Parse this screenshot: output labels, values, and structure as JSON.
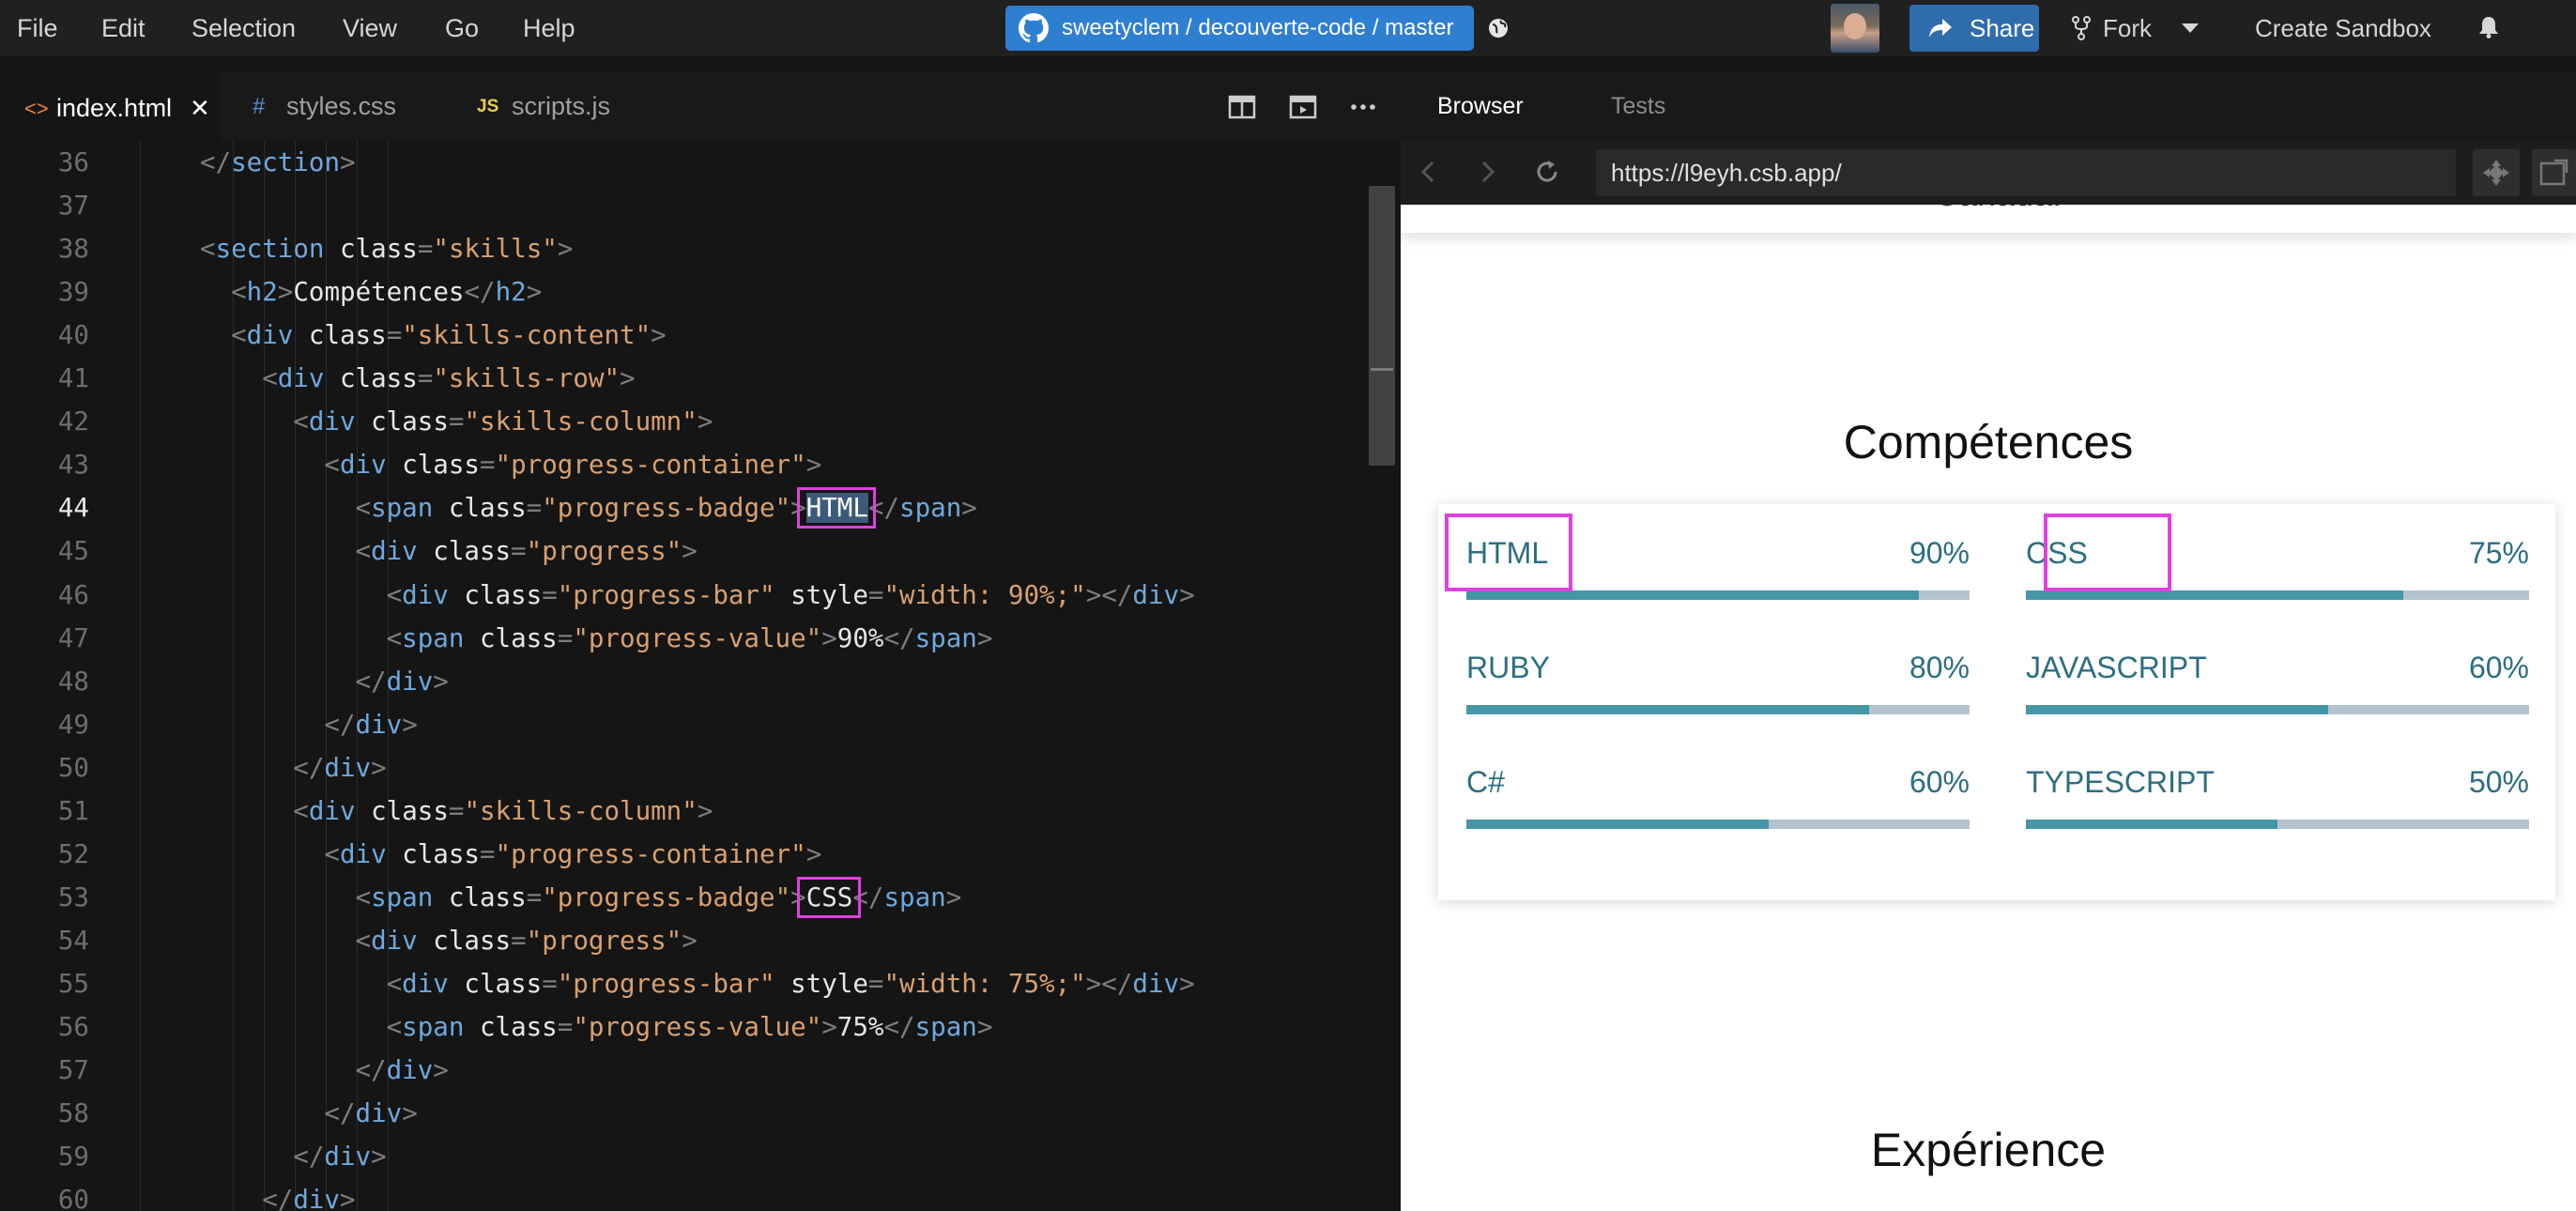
{
  "menu": [
    "File",
    "Edit",
    "Selection",
    "View",
    "Go",
    "Help"
  ],
  "repo": {
    "label": "sweetyclem / decouverte-code / master",
    "owner": "sweetyclem",
    "repo": "decouverte-code",
    "branch": "master"
  },
  "header": {
    "share_label": "Share",
    "fork_label": "Fork",
    "create_sandbox_label": "Create Sandbox"
  },
  "editor_tabs": [
    {
      "label": "index.html",
      "icon": "html-file-icon",
      "active": true
    },
    {
      "label": "styles.css",
      "icon": "css-file-icon",
      "active": false
    },
    {
      "label": "scripts.js",
      "icon": "js-file-icon",
      "active": false
    }
  ],
  "editor": {
    "current_line": 44,
    "lines": [
      {
        "n": "36",
        "code": "</section>"
      },
      {
        "n": "37",
        "code": ""
      },
      {
        "n": "38",
        "code": "<section class=\"skills\">"
      },
      {
        "n": "39",
        "code": "<h2>Compétences</h2>"
      },
      {
        "n": "40",
        "code": "<div class=\"skills-content\">"
      },
      {
        "n": "41",
        "code": "<div class=\"skills-row\">"
      },
      {
        "n": "42",
        "code": "<div class=\"skills-column\">"
      },
      {
        "n": "43",
        "code": "<div class=\"progress-container\">"
      },
      {
        "n": "44",
        "code": "<span class=\"progress-badge\">HTML</span>"
      },
      {
        "n": "45",
        "code": "<div class=\"progress\">"
      },
      {
        "n": "46",
        "code": "<div class=\"progress-bar\" style=\"width: 90%;\"></div>"
      },
      {
        "n": "47",
        "code": "<span class=\"progress-value\">90%</span>"
      },
      {
        "n": "48",
        "code": "</div>"
      },
      {
        "n": "49",
        "code": "</div>"
      },
      {
        "n": "50",
        "code": "</div>"
      },
      {
        "n": "51",
        "code": "<div class=\"skills-column\">"
      },
      {
        "n": "52",
        "code": "<div class=\"progress-container\">"
      },
      {
        "n": "53",
        "code": "<span class=\"progress-badge\">CSS</span>"
      },
      {
        "n": "54",
        "code": "<div class=\"progress\">"
      },
      {
        "n": "55",
        "code": "<div class=\"progress-bar\" style=\"width: 75%;\"></div>"
      },
      {
        "n": "56",
        "code": "<span class=\"progress-value\">75%</span>"
      },
      {
        "n": "57",
        "code": "</div>"
      },
      {
        "n": "58",
        "code": "</div>"
      },
      {
        "n": "59",
        "code": "</div>"
      },
      {
        "n": "60",
        "code": "</div>"
      }
    ]
  },
  "browser": {
    "tabs": [
      "Browser",
      "Tests"
    ],
    "url": "https://l9eyh.csb.app/",
    "cut_text": "Canada.",
    "heading": "Compétences",
    "next_heading": "Expérience",
    "skills": [
      {
        "name": "HTML",
        "value": "90%",
        "level": 0.9
      },
      {
        "name": "CSS",
        "value": "75%",
        "level": 0.75
      },
      {
        "name": "RUBY",
        "value": "80%",
        "level": 0.8
      },
      {
        "name": "JAVASCRIPT",
        "value": "60%",
        "level": 0.6
      },
      {
        "name": "C#",
        "value": "60%",
        "level": 0.6
      },
      {
        "name": "TYPESCRIPT",
        "value": "50%",
        "level": 0.5
      }
    ]
  },
  "colors": {
    "accent": "#2f7fd1",
    "highlight": "#e040e0",
    "progress_fill": "#4596a6",
    "progress_track": "#b4c4cf",
    "skill_text": "#2c6e80"
  }
}
